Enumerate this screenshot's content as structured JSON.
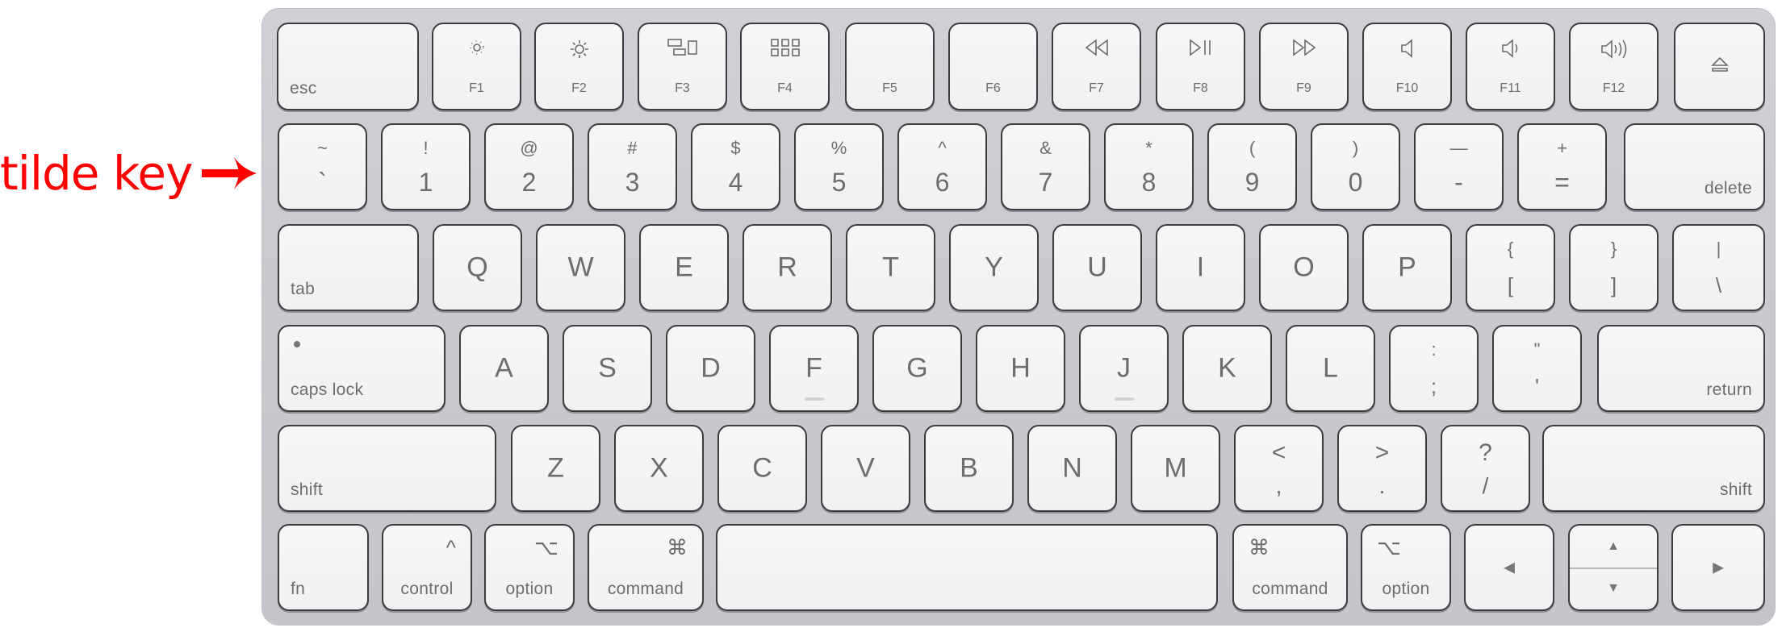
{
  "annotation": {
    "text": "tilde key",
    "arrow": "right-arrow-icon",
    "color": "#ff0000"
  },
  "keyboard": {
    "colors": {
      "body": "#c9cbd0",
      "key_face": "#f4f4f4",
      "key_border": "#3b3c3f",
      "legend": "#6d6d6d"
    },
    "function_row": [
      {
        "id": "esc",
        "label": "esc"
      },
      {
        "id": "f1",
        "label": "F1",
        "icon": "brightness-down-icon"
      },
      {
        "id": "f2",
        "label": "F2",
        "icon": "brightness-up-icon"
      },
      {
        "id": "f3",
        "label": "F3",
        "icon": "mission-control-icon"
      },
      {
        "id": "f4",
        "label": "F4",
        "icon": "launchpad-icon"
      },
      {
        "id": "f5",
        "label": "F5"
      },
      {
        "id": "f6",
        "label": "F6"
      },
      {
        "id": "f7",
        "label": "F7",
        "icon": "rewind-icon"
      },
      {
        "id": "f8",
        "label": "F8",
        "icon": "play-pause-icon"
      },
      {
        "id": "f9",
        "label": "F9",
        "icon": "fast-forward-icon"
      },
      {
        "id": "f10",
        "label": "F10",
        "icon": "mute-icon"
      },
      {
        "id": "f11",
        "label": "F11",
        "icon": "volume-down-icon"
      },
      {
        "id": "f12",
        "label": "F12",
        "icon": "volume-up-icon"
      },
      {
        "id": "eject",
        "label": "⏏",
        "icon": "eject-icon"
      }
    ],
    "number_row": [
      {
        "id": "tilde",
        "top": "~",
        "bottom": "`"
      },
      {
        "id": "1",
        "top": "!",
        "bottom": "1"
      },
      {
        "id": "2",
        "top": "@",
        "bottom": "2"
      },
      {
        "id": "3",
        "top": "#",
        "bottom": "3"
      },
      {
        "id": "4",
        "top": "$",
        "bottom": "4"
      },
      {
        "id": "5",
        "top": "%",
        "bottom": "5"
      },
      {
        "id": "6",
        "top": "^",
        "bottom": "6"
      },
      {
        "id": "7",
        "top": "&",
        "bottom": "7"
      },
      {
        "id": "8",
        "top": "*",
        "bottom": "8"
      },
      {
        "id": "9",
        "top": "(",
        "bottom": "9"
      },
      {
        "id": "0",
        "top": ")",
        "bottom": "0"
      },
      {
        "id": "minus",
        "top": "—",
        "bottom": "-"
      },
      {
        "id": "equals",
        "top": "+",
        "bottom": "="
      },
      {
        "id": "delete",
        "label": "delete"
      }
    ],
    "top_row": [
      {
        "id": "tab",
        "label": "tab"
      },
      {
        "id": "q",
        "label": "Q"
      },
      {
        "id": "w",
        "label": "W"
      },
      {
        "id": "e",
        "label": "E"
      },
      {
        "id": "r",
        "label": "R"
      },
      {
        "id": "t",
        "label": "T"
      },
      {
        "id": "y",
        "label": "Y"
      },
      {
        "id": "u",
        "label": "U"
      },
      {
        "id": "i",
        "label": "I"
      },
      {
        "id": "o",
        "label": "O"
      },
      {
        "id": "p",
        "label": "P"
      },
      {
        "id": "lbracket",
        "top": "{",
        "bottom": "["
      },
      {
        "id": "rbracket",
        "top": "}",
        "bottom": "]"
      },
      {
        "id": "backslash",
        "top": "|",
        "bottom": "\\"
      }
    ],
    "home_row": [
      {
        "id": "capslock",
        "label": "caps lock"
      },
      {
        "id": "a",
        "label": "A"
      },
      {
        "id": "s",
        "label": "S"
      },
      {
        "id": "d",
        "label": "D"
      },
      {
        "id": "f",
        "label": "F"
      },
      {
        "id": "g",
        "label": "G"
      },
      {
        "id": "h",
        "label": "H"
      },
      {
        "id": "j",
        "label": "J"
      },
      {
        "id": "k",
        "label": "K"
      },
      {
        "id": "l",
        "label": "L"
      },
      {
        "id": "semicolon",
        "top": ":",
        "bottom": ";"
      },
      {
        "id": "quote",
        "top": "\"",
        "bottom": "'"
      },
      {
        "id": "return",
        "label": "return"
      }
    ],
    "bottom_row": [
      {
        "id": "lshift",
        "label": "shift"
      },
      {
        "id": "z",
        "label": "Z"
      },
      {
        "id": "x",
        "label": "X"
      },
      {
        "id": "c",
        "label": "C"
      },
      {
        "id": "v",
        "label": "V"
      },
      {
        "id": "b",
        "label": "B"
      },
      {
        "id": "n",
        "label": "N"
      },
      {
        "id": "m",
        "label": "M"
      },
      {
        "id": "comma",
        "top": "<",
        "bottom": ","
      },
      {
        "id": "period",
        "top": ">",
        "bottom": "."
      },
      {
        "id": "slash",
        "top": "?",
        "bottom": "/"
      },
      {
        "id": "rshift",
        "label": "shift"
      }
    ],
    "modifier_row": [
      {
        "id": "fn",
        "label": "fn"
      },
      {
        "id": "lcontrol",
        "label": "control",
        "symbol": "^"
      },
      {
        "id": "loption",
        "label": "option",
        "symbol": "⌥"
      },
      {
        "id": "lcommand",
        "label": "command",
        "symbol": "⌘"
      },
      {
        "id": "space",
        "label": ""
      },
      {
        "id": "rcommand",
        "label": "command",
        "symbol": "⌘"
      },
      {
        "id": "roption",
        "label": "option",
        "symbol": "⌥"
      },
      {
        "id": "left",
        "symbol": "◀"
      },
      {
        "id": "updown",
        "up": "▲",
        "down": "▼"
      },
      {
        "id": "right",
        "symbol": "▶"
      }
    ]
  }
}
